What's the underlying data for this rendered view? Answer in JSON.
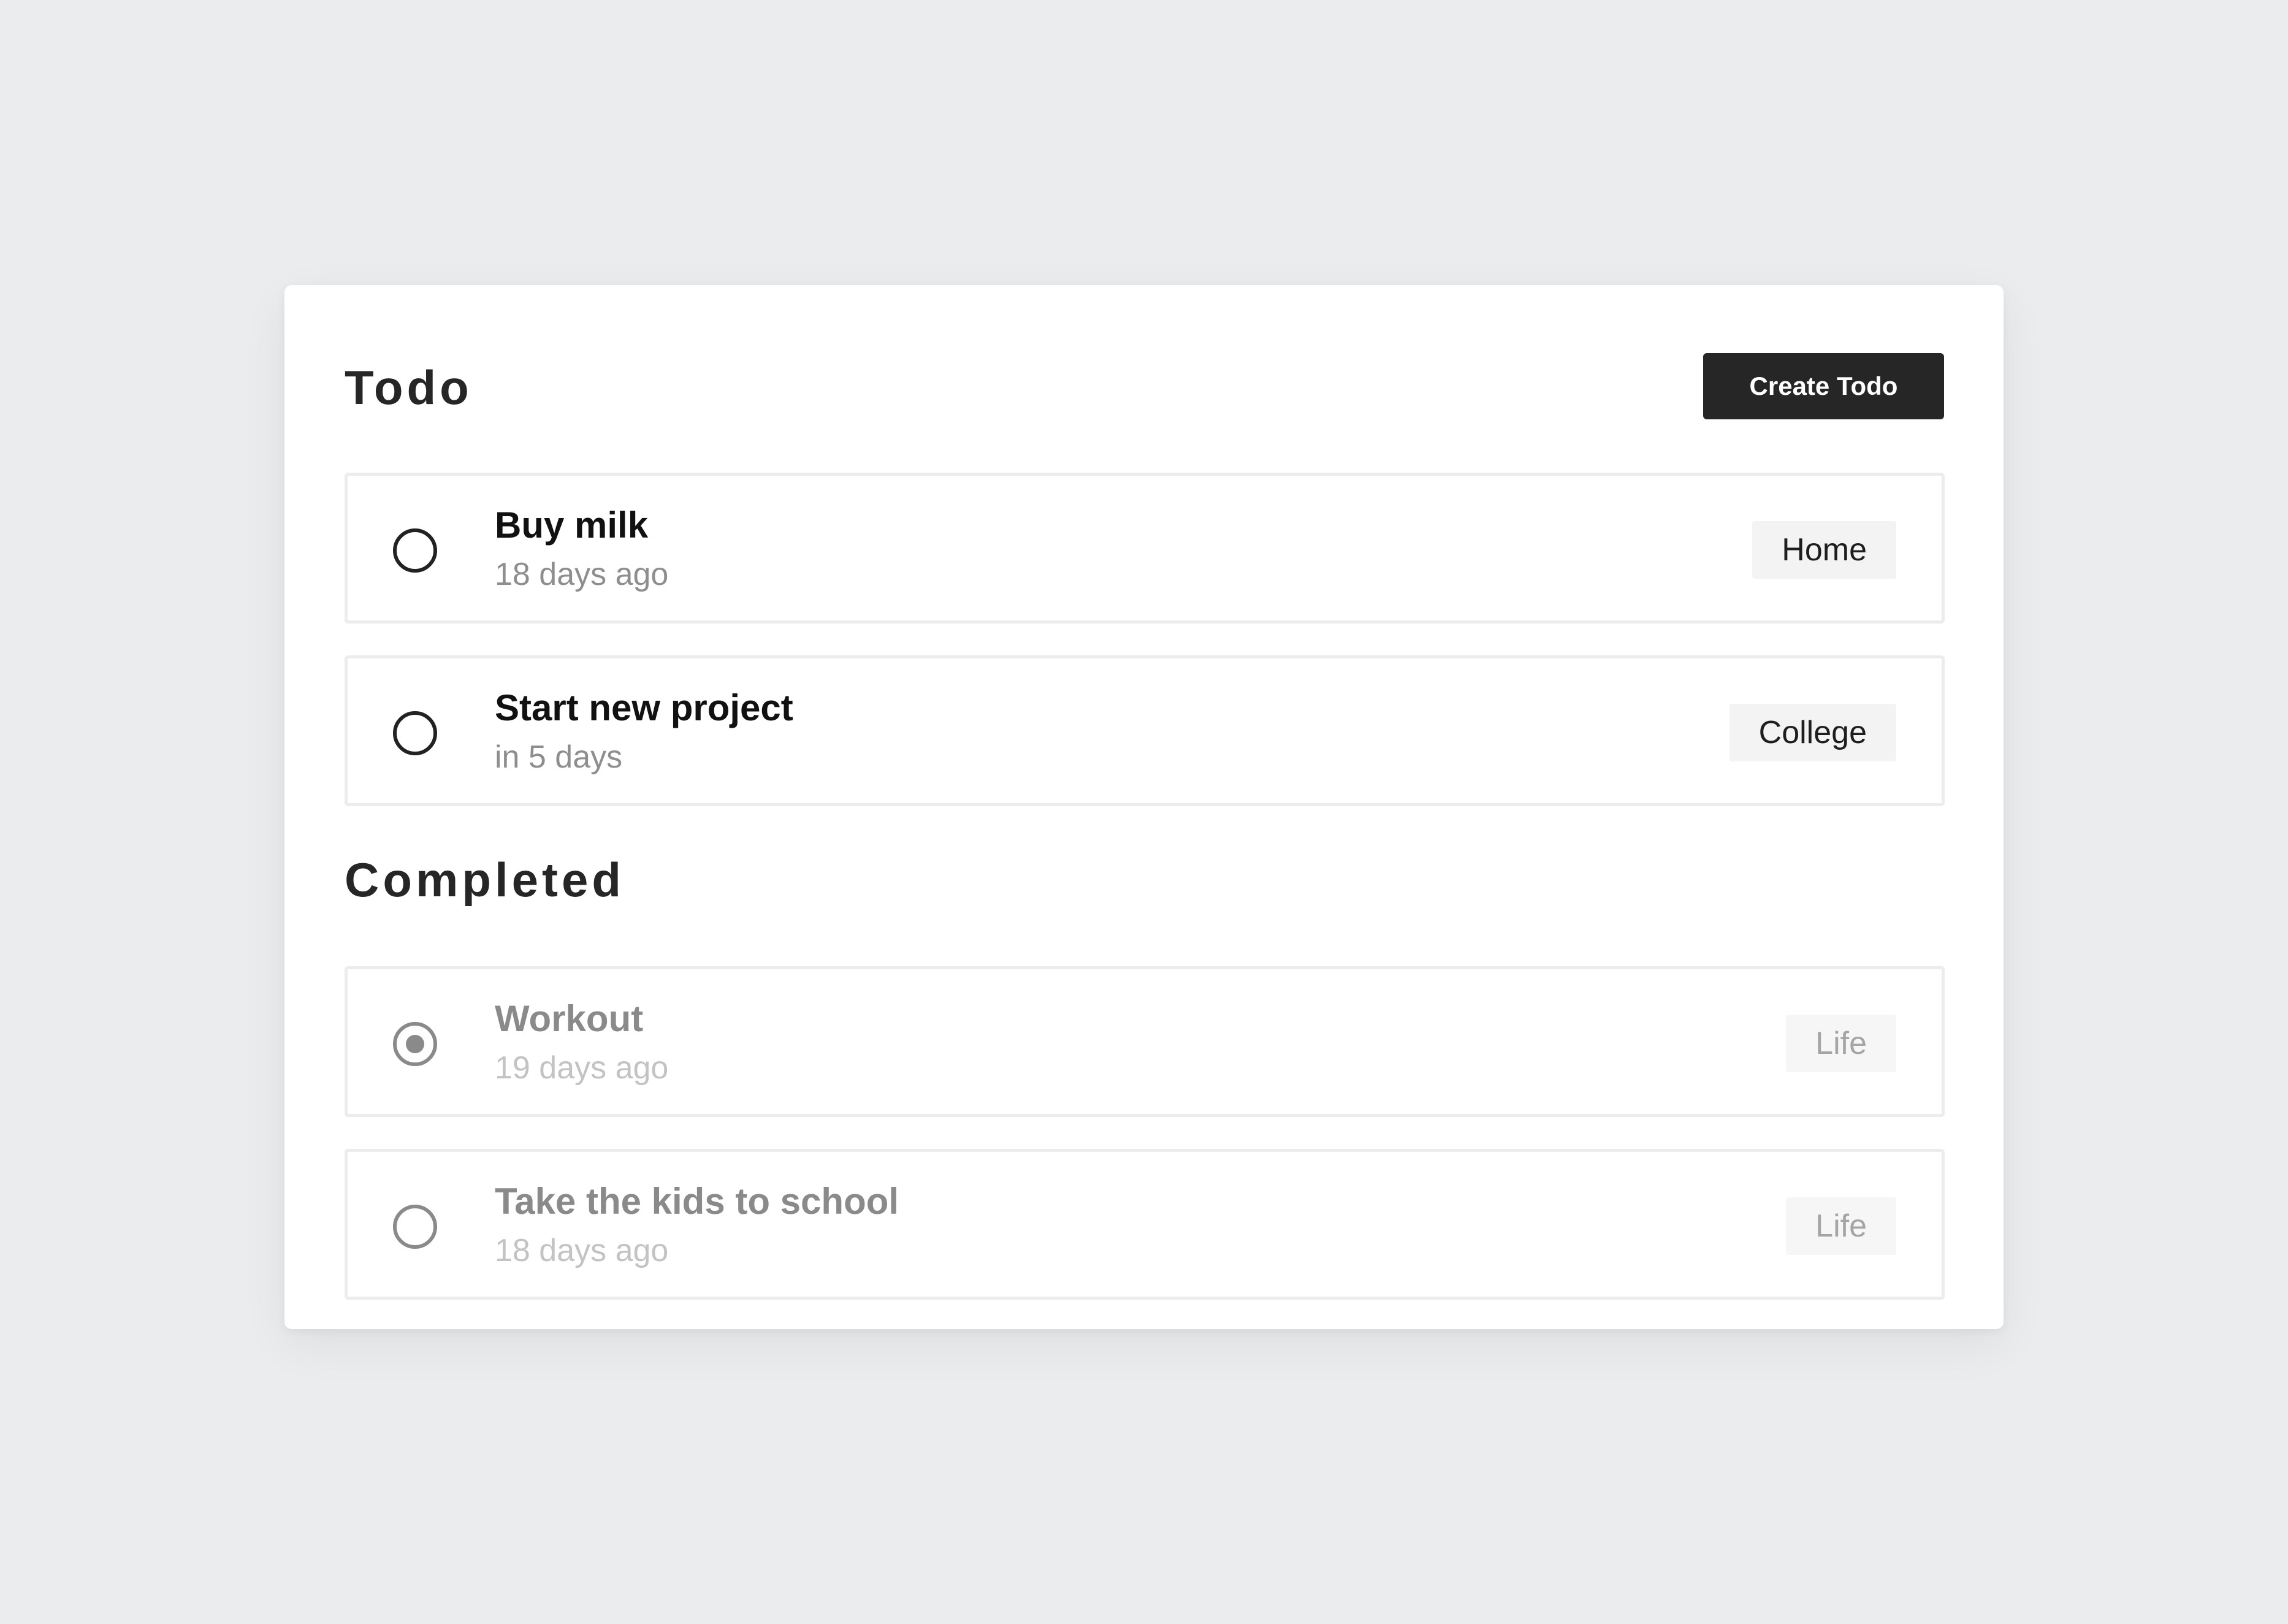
{
  "header": {
    "title": "Todo",
    "create_button_label": "Create Todo"
  },
  "todo": {
    "items": [
      {
        "title": "Buy milk",
        "time": "18 days ago",
        "tag": "Home",
        "checked": false
      },
      {
        "title": "Start new project",
        "time": "in 5 days",
        "tag": "College",
        "checked": false
      }
    ]
  },
  "completed": {
    "title": "Completed",
    "items": [
      {
        "title": "Workout",
        "time": "19 days ago",
        "tag": "Life",
        "checked": true
      },
      {
        "title": "Take the kids to school",
        "time": "18 days ago",
        "tag": "Life",
        "checked": false
      }
    ]
  },
  "colors": {
    "background": "#ebecee",
    "card": "#ffffff",
    "primary_button": "#262626",
    "completed_text": "#8a8a8a"
  }
}
